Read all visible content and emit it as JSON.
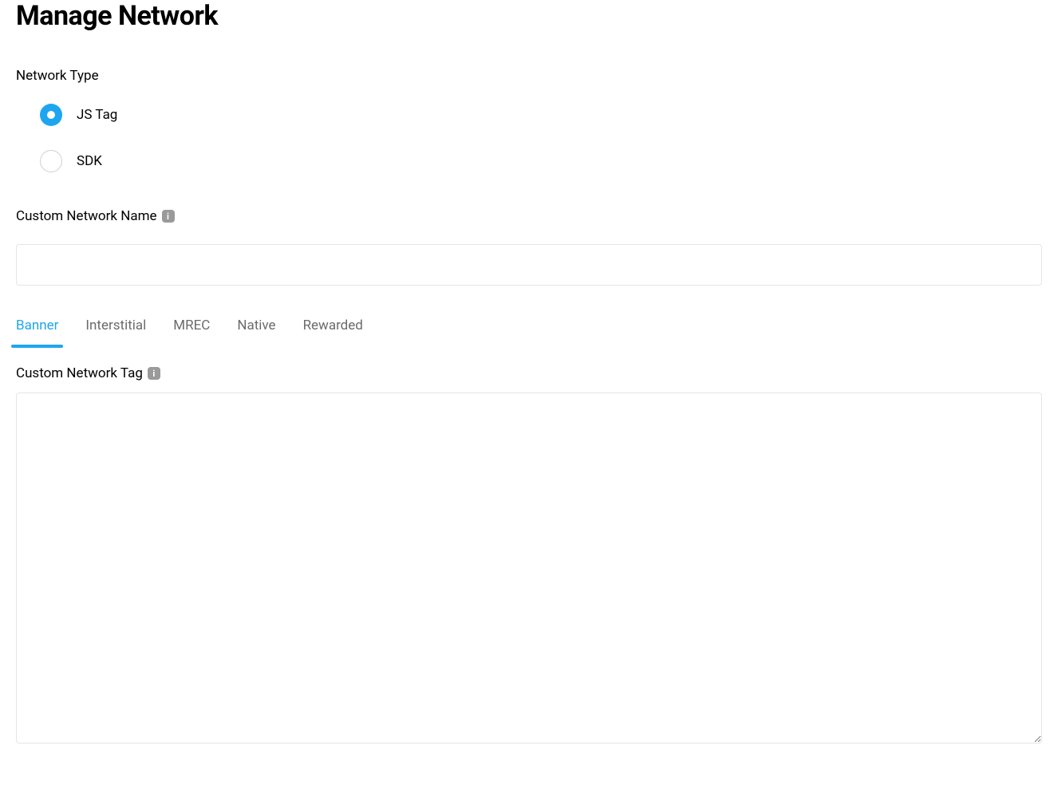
{
  "page": {
    "title": "Manage Network"
  },
  "network_type": {
    "label": "Network Type",
    "options": [
      {
        "label": "JS Tag",
        "selected": true
      },
      {
        "label": "SDK",
        "selected": false
      }
    ]
  },
  "custom_network_name": {
    "label": "Custom Network Name",
    "value": ""
  },
  "tabs": [
    {
      "label": "Banner",
      "active": true
    },
    {
      "label": "Interstitial",
      "active": false
    },
    {
      "label": "MREC",
      "active": false
    },
    {
      "label": "Native",
      "active": false
    },
    {
      "label": "Rewarded",
      "active": false
    }
  ],
  "custom_network_tag": {
    "label": "Custom Network Tag",
    "value": ""
  }
}
